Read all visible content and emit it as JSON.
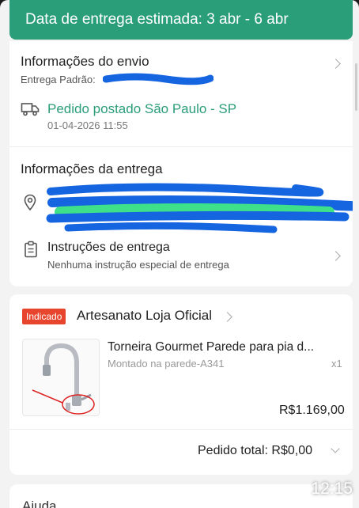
{
  "banner": {
    "text": "Data de entrega estimada: 3 abr - 6 abr"
  },
  "shipping": {
    "title": "Informações do envio",
    "method_label": "Entrega Padrão:",
    "status": "Pedido postado São Paulo - SP",
    "timestamp": "01-04-2026 11:55"
  },
  "delivery": {
    "title": "Informações da entrega",
    "instructions_title": "Instruções de entrega",
    "instructions_text": "Nenhuma instrução especial de entrega"
  },
  "store": {
    "badge": "Indicado",
    "name": "Artesanato Loja Oficial"
  },
  "product": {
    "title": "Torneira Gourmet Parede para pia d...",
    "variant": "Montado na parede-A341",
    "quantity": "x1",
    "price": "R$1.169,00"
  },
  "order": {
    "total_label": "Pedido total: R$0,00"
  },
  "next_section": {
    "title": "Ajuda"
  },
  "status_bar": {
    "time": "12:15"
  },
  "colors": {
    "accent": "#2a9d79",
    "badge": "#e8452f",
    "redaction_blue": "#1565e0",
    "redaction_green": "#3ee08a"
  }
}
